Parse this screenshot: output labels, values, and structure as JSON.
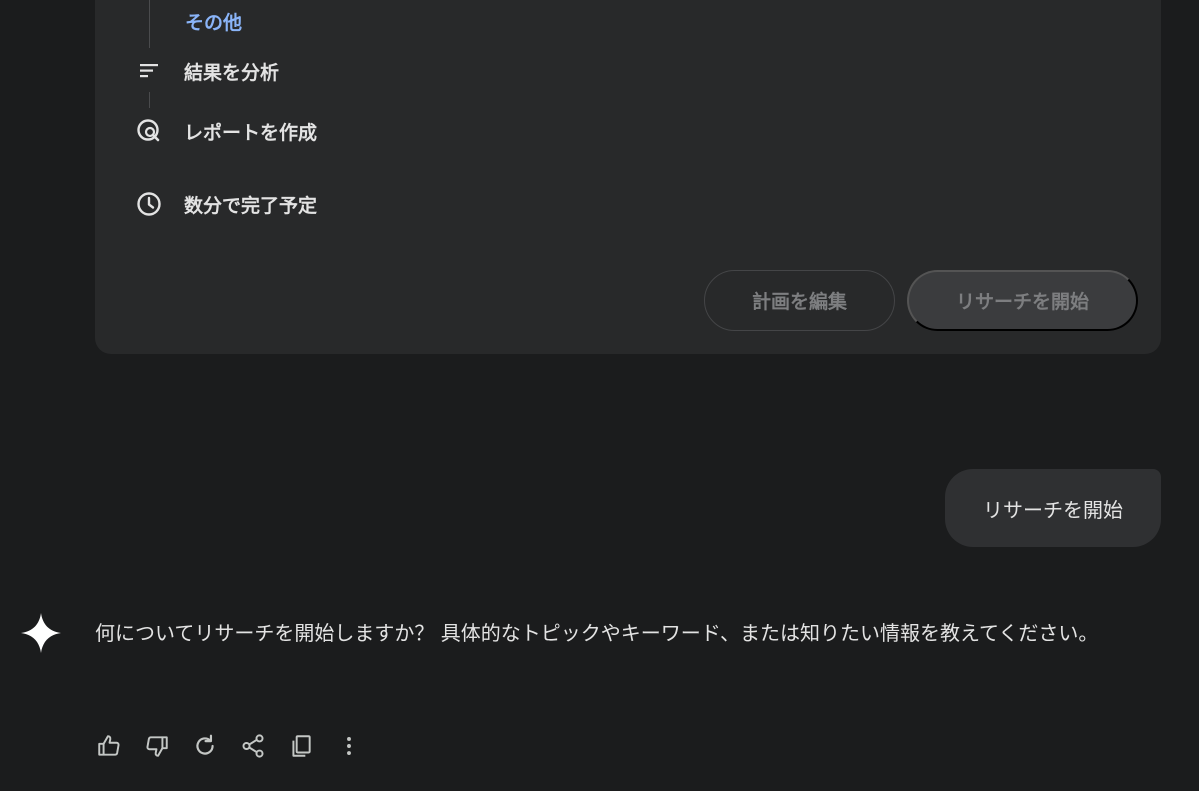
{
  "plan": {
    "steps": {
      "other_label": "その他",
      "analyze_label": "結果を分析",
      "report_label": "レポートを作成",
      "eta_label": "数分で完了予定"
    },
    "icons": {
      "analyze": "sort-lines-icon",
      "report": "report-search-icon",
      "eta": "clock-icon"
    },
    "buttons": {
      "edit_label": "計画を編集",
      "start_label": "リサーチを開始"
    }
  },
  "user_message": {
    "text": "リサーチを開始"
  },
  "response": {
    "text": "何についてリサーチを開始しますか？ 具体的なトピックやキーワード、または知りたい情報を教えてください。",
    "actions": [
      "thumbs-up-icon",
      "thumbs-down-icon",
      "regenerate-icon",
      "share-icon",
      "copy-icon",
      "more-vert-icon"
    ]
  },
  "colors": {
    "background": "#1b1c1d",
    "card": "#28292a",
    "accent_link": "#8ab4f8",
    "text": "#e3e3e3",
    "muted_button_text": "#7d7e80"
  }
}
